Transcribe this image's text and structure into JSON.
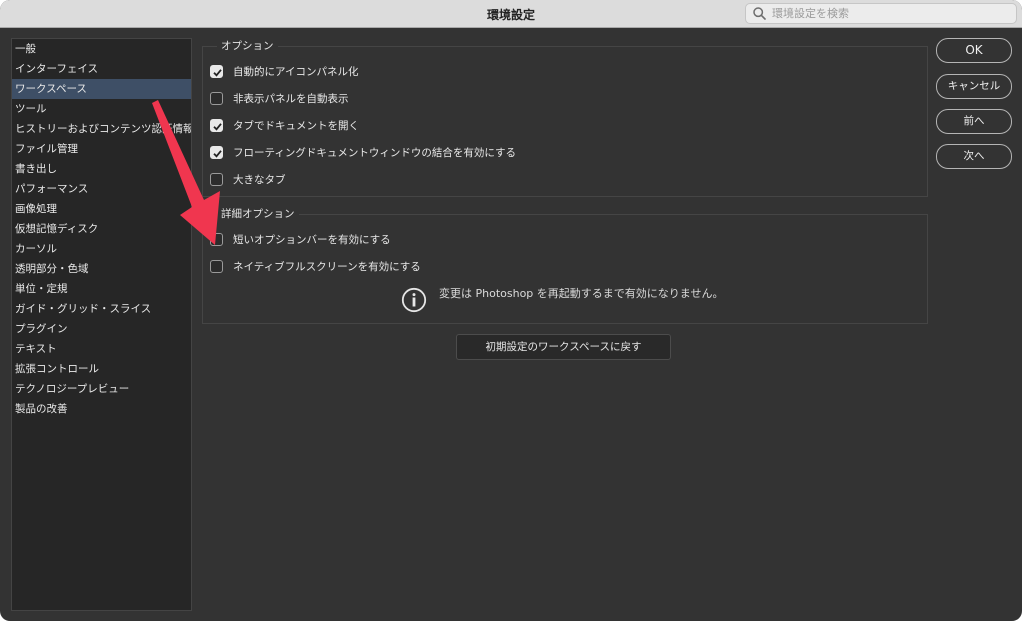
{
  "window": {
    "title": "環境設定"
  },
  "search": {
    "placeholder": "環境設定を検索"
  },
  "sidebar": {
    "selected_index": 2,
    "items": [
      "一般",
      "インターフェイス",
      "ワークスペース",
      "ツール",
      "ヒストリーおよびコンテンツ認証情報",
      "ファイル管理",
      "書き出し",
      "パフォーマンス",
      "画像処理",
      "仮想記憶ディスク",
      "カーソル",
      "透明部分・色域",
      "単位・定規",
      "ガイド・グリッド・スライス",
      "プラグイン",
      "テキスト",
      "拡張コントロール",
      "テクノロジープレビュー",
      "製品の改善"
    ]
  },
  "options": {
    "title": "オプション",
    "items": [
      {
        "label": "自動的にアイコンパネル化",
        "checked": true
      },
      {
        "label": "非表示パネルを自動表示",
        "checked": false
      },
      {
        "label": "タブでドキュメントを開く",
        "checked": true
      },
      {
        "label": "フローティングドキュメントウィンドウの結合を有効にする",
        "checked": true
      },
      {
        "label": "大きなタブ",
        "checked": false
      }
    ]
  },
  "advanced": {
    "title": "詳細オプション",
    "items": [
      {
        "label": "短いオプションバーを有効にする",
        "checked": false
      },
      {
        "label": "ネイティブフルスクリーンを有効にする",
        "checked": false
      }
    ],
    "info": "変更は Photoshop を再起動するまで有効になりません。"
  },
  "reset_button": "初期設定のワークスペースに戻す",
  "buttons": {
    "ok": "OK",
    "cancel": "キャンセル",
    "prev": "前へ",
    "next": "次へ"
  },
  "colors": {
    "selection": "#3e4f66",
    "arrow": "#f0364f"
  }
}
